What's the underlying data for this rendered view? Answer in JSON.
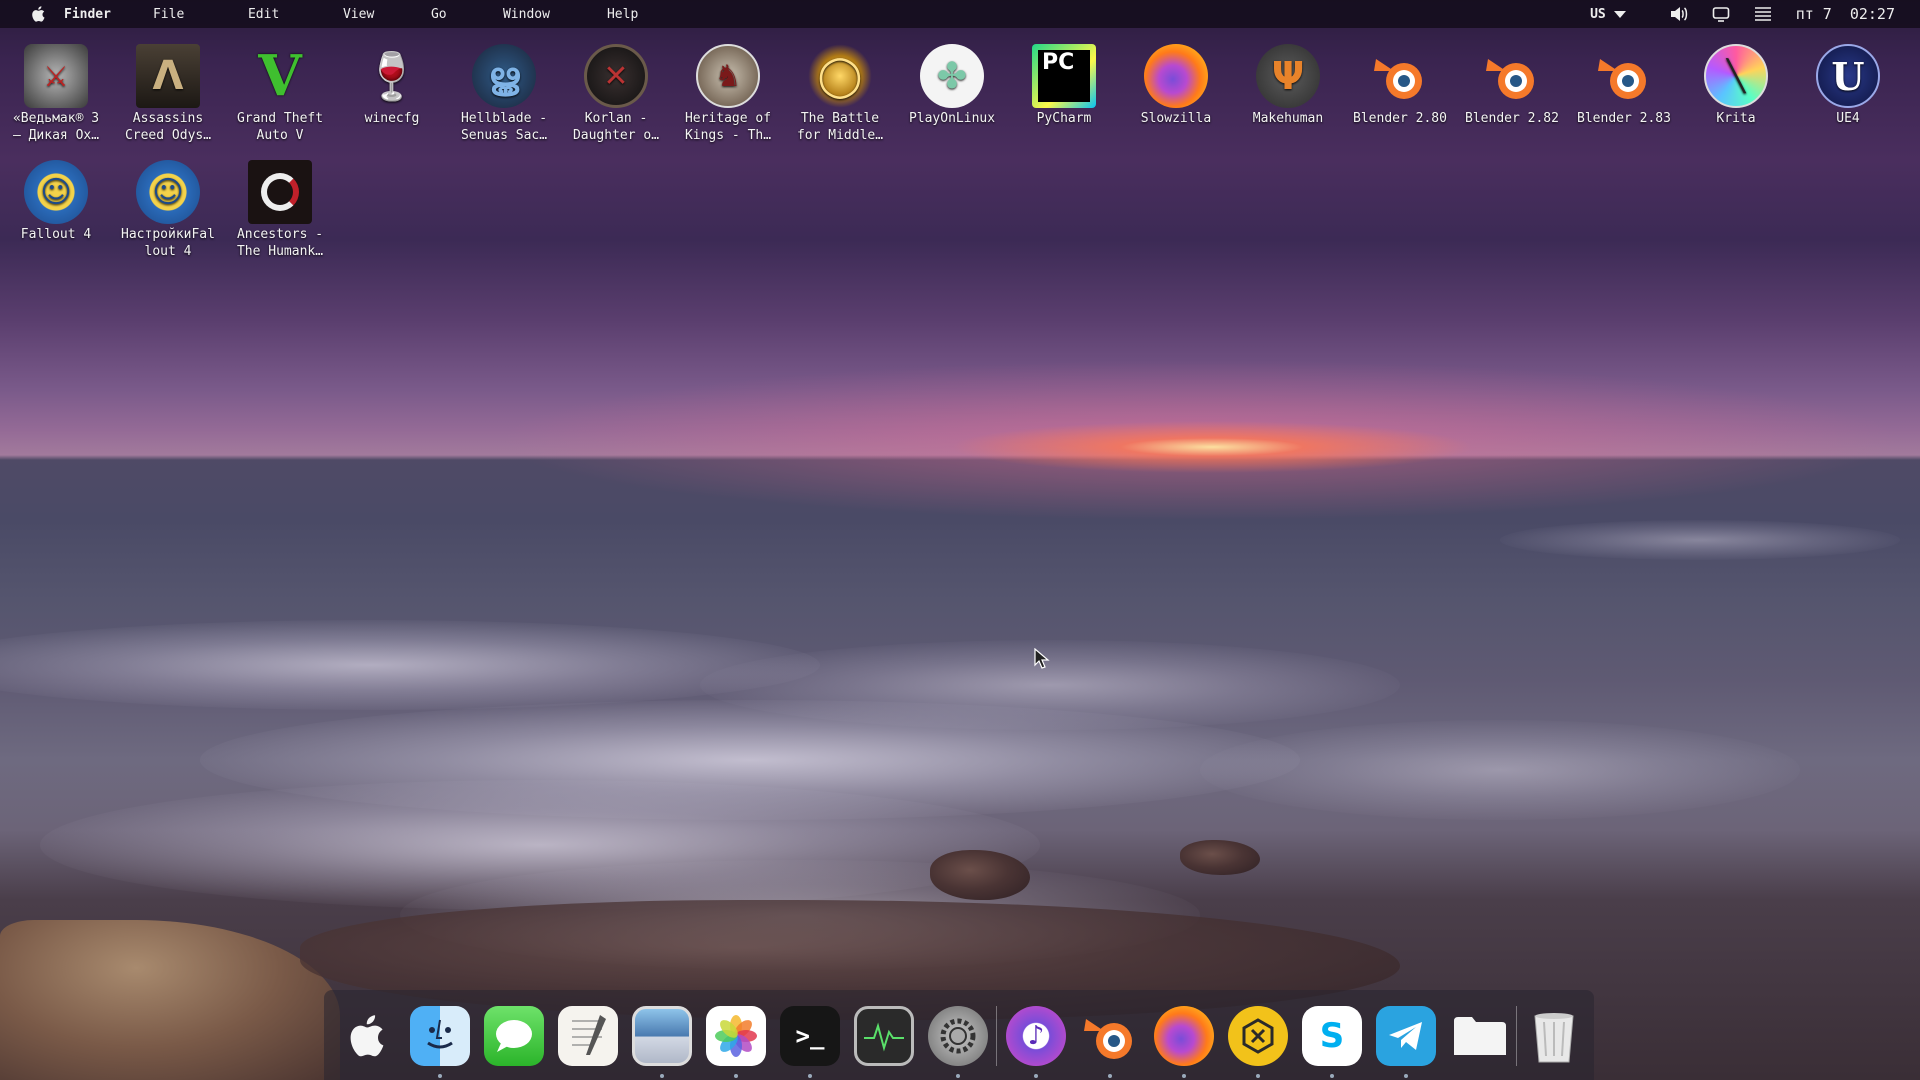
{
  "menubar": {
    "app_name": "Finder",
    "menus": [
      "File",
      "Edit",
      "View",
      "Go",
      "Window",
      "Help"
    ],
    "status": {
      "keyboard_layout": "US",
      "date": "пт 7",
      "time": "02:27"
    },
    "icons": [
      "apple-logo-icon",
      "volume-icon",
      "display-icon",
      "menu-lines-icon"
    ]
  },
  "desktop": {
    "row1": [
      {
        "label": "«Ведьмак® 3\n– Дикая Ох…",
        "icon": "witcher-icon"
      },
      {
        "label": "Assassins\nCreed Odys…",
        "icon": "assassins-creed-icon"
      },
      {
        "label": "Grand Theft\nAuto V",
        "icon": "gta-v-icon"
      },
      {
        "label": "winecfg",
        "icon": "wine-glass-icon"
      },
      {
        "label": "Hellblade -\nSenuas Sac…",
        "icon": "hellblade-icon"
      },
      {
        "label": "Korlan -\nDaughter o…",
        "icon": "korlan-icon"
      },
      {
        "label": "Heritage of\nKings - Th…",
        "icon": "heritage-of-kings-icon"
      },
      {
        "label": "The Battle\nfor Middle…",
        "icon": "ring-icon"
      },
      {
        "label": "PlayOnLinux",
        "icon": "clover-icon"
      },
      {
        "label": "PyCharm",
        "icon": "pycharm-icon"
      },
      {
        "label": "Slowzilla",
        "icon": "firefox-icon"
      },
      {
        "label": "Makehuman",
        "icon": "makehuman-icon"
      },
      {
        "label": "Blender 2.80",
        "icon": "blender-icon"
      },
      {
        "label": "Blender 2.82",
        "icon": "blender-icon"
      },
      {
        "label": "Blender 2.83",
        "icon": "blender-icon"
      },
      {
        "label": "Krita",
        "icon": "krita-icon"
      },
      {
        "label": "UE4",
        "icon": "unreal-engine-icon"
      }
    ],
    "row2": [
      {
        "label": "Fallout 4",
        "icon": "vault-boy-icon"
      },
      {
        "label": "НастройкиFal\nlout 4",
        "icon": "vault-boy-icon"
      },
      {
        "label": "Ancestors -\nThe Humank…",
        "icon": "ancestors-icon"
      }
    ]
  },
  "dock": {
    "items": [
      {
        "name": "launchpad-apple-icon",
        "glyph": ""
      },
      {
        "name": "finder-icon",
        "glyph": ""
      },
      {
        "name": "messages-icon",
        "glyph": ""
      },
      {
        "name": "text-editor-icon",
        "glyph": ""
      },
      {
        "name": "image-viewer-icon",
        "glyph": ""
      },
      {
        "name": "photos-icon",
        "glyph": ""
      },
      {
        "name": "terminal-icon",
        "glyph": ">_"
      },
      {
        "name": "activity-monitor-icon",
        "glyph": ""
      },
      {
        "name": "system-settings-icon",
        "glyph": ""
      },
      {
        "name": "audio-app-icon",
        "glyph": ""
      },
      {
        "name": "blender-dock-icon",
        "glyph": ""
      },
      {
        "name": "firefox-dock-icon",
        "glyph": ""
      },
      {
        "name": "hexagon-app-icon",
        "glyph": ""
      },
      {
        "name": "skype-icon",
        "glyph": "S"
      },
      {
        "name": "telegram-icon",
        "glyph": ""
      },
      {
        "name": "files-folder-icon",
        "glyph": ""
      },
      {
        "name": "trash-icon",
        "glyph": ""
      }
    ]
  }
}
